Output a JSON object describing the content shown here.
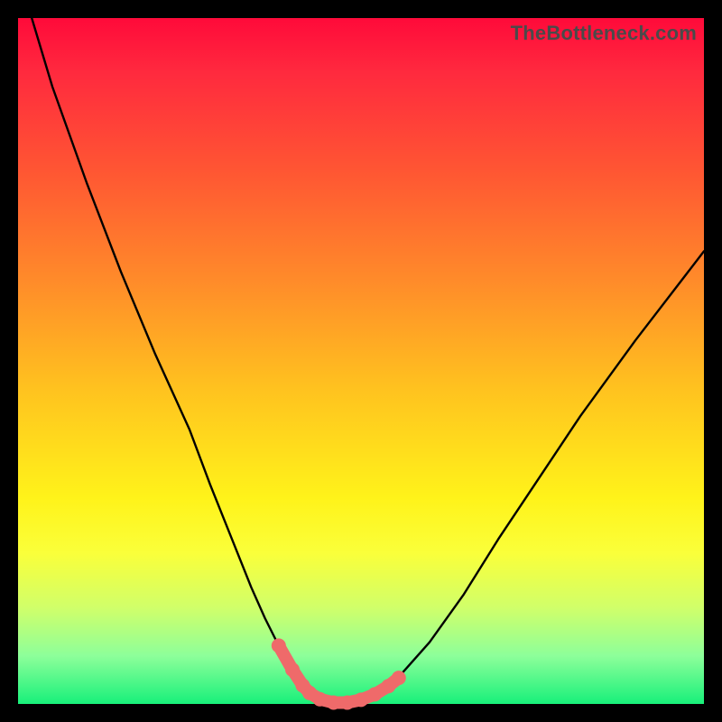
{
  "watermark": {
    "text": "TheBottleneck.com"
  },
  "chart_data": {
    "type": "line",
    "title": "",
    "xlabel": "",
    "ylabel": "",
    "xlim": [
      0,
      100
    ],
    "ylim": [
      0,
      100
    ],
    "grid": false,
    "legend": false,
    "series": [
      {
        "name": "bottleneck-curve",
        "color": "#000000",
        "x": [
          2,
          5,
          10,
          15,
          20,
          25,
          28,
          30,
          32,
          34,
          36,
          38,
          40,
          41.5,
          42.5,
          44,
          46,
          48,
          50,
          52,
          54,
          56,
          60,
          65,
          70,
          76,
          82,
          90,
          100
        ],
        "y": [
          100,
          90,
          76,
          63,
          51,
          40,
          32,
          27,
          22,
          17,
          12.5,
          8.5,
          5,
          2.7,
          1.6,
          0.7,
          0.2,
          0.2,
          0.6,
          1.4,
          2.6,
          4.5,
          9,
          16,
          24,
          33,
          42,
          53,
          66
        ]
      },
      {
        "name": "optimal-region-highlight",
        "color": "#ef6a6a",
        "x": [
          38,
          40,
          41.5,
          42.5,
          44,
          46,
          48,
          50,
          52,
          54,
          55.5
        ],
        "y": [
          8.5,
          5,
          2.7,
          1.6,
          0.7,
          0.2,
          0.2,
          0.6,
          1.4,
          2.6,
          3.8
        ]
      }
    ],
    "background_gradient": {
      "top": "#ff0a3a",
      "mid": "#fff31a",
      "bottom": "#18f07a"
    }
  }
}
